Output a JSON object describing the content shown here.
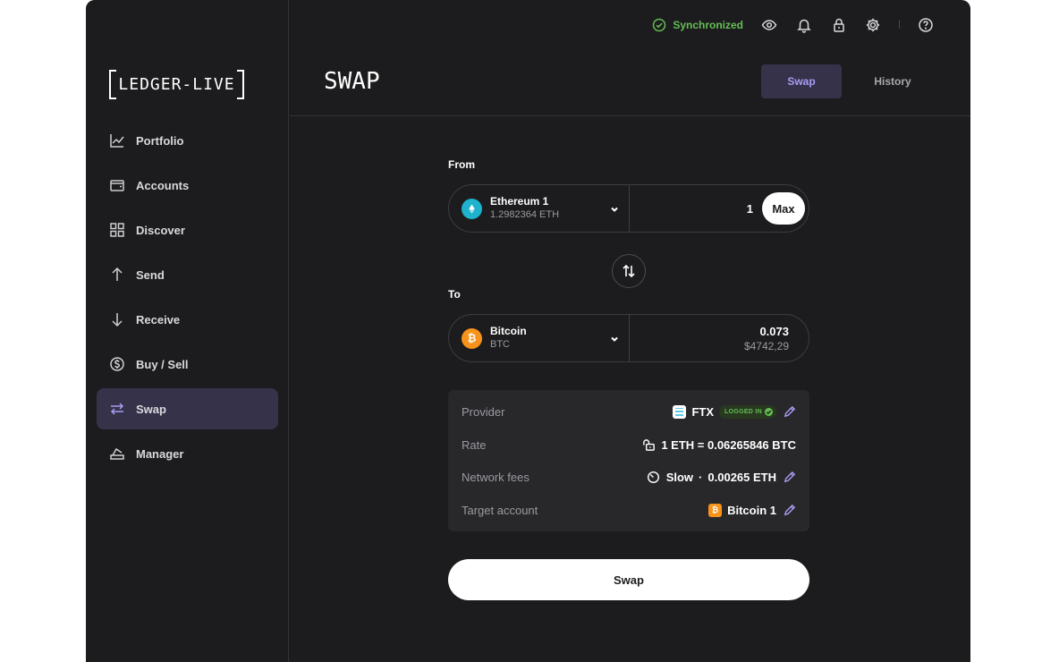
{
  "window": {
    "traffic_lights": [
      "close",
      "minimize",
      "maximize"
    ]
  },
  "colors": {
    "accent": "#a79cf2",
    "accent_bg": "#35324a",
    "sync_green": "#66be54",
    "eth": "#1fb2cc",
    "btc": "#f7931a"
  },
  "sidebar": {
    "logo": "LEDGER-LIVE",
    "items": [
      {
        "label": "Portfolio",
        "icon": "chart-icon"
      },
      {
        "label": "Accounts",
        "icon": "wallet-icon"
      },
      {
        "label": "Discover",
        "icon": "grid-icon"
      },
      {
        "label": "Send",
        "icon": "arrow-up-icon"
      },
      {
        "label": "Receive",
        "icon": "arrow-down-icon"
      },
      {
        "label": "Buy / Sell",
        "icon": "dollar-icon"
      },
      {
        "label": "Swap",
        "icon": "swap-icon",
        "active": true
      },
      {
        "label": "Manager",
        "icon": "manager-icon"
      }
    ]
  },
  "topbar": {
    "sync_status": "Synchronized",
    "icons": [
      "eye-icon",
      "bell-icon",
      "lock-icon",
      "gear-icon",
      "help-icon"
    ]
  },
  "header": {
    "title": "SWAP",
    "tabs": [
      {
        "label": "Swap",
        "active": true
      },
      {
        "label": "History"
      }
    ]
  },
  "from": {
    "label": "From",
    "account_name": "Ethereum 1",
    "balance": "1.2982364 ETH",
    "amount": "1",
    "max_label": "Max"
  },
  "to": {
    "label": "To",
    "account_name": "Bitcoin",
    "ticker": "BTC",
    "amount": "0.073",
    "fiat": "$4742,29"
  },
  "summary": {
    "provider_label": "Provider",
    "provider_name": "FTX",
    "provider_badge": "LOGGED IN",
    "rate_label": "Rate",
    "rate_value": "1 ETH = 0.06265846 BTC",
    "fees_label": "Network fees",
    "fees_speed": "Slow",
    "fees_separator": "·",
    "fees_value": "0.00265 ETH",
    "target_label": "Target account",
    "target_value": "Bitcoin 1"
  },
  "swap_button": "Swap"
}
